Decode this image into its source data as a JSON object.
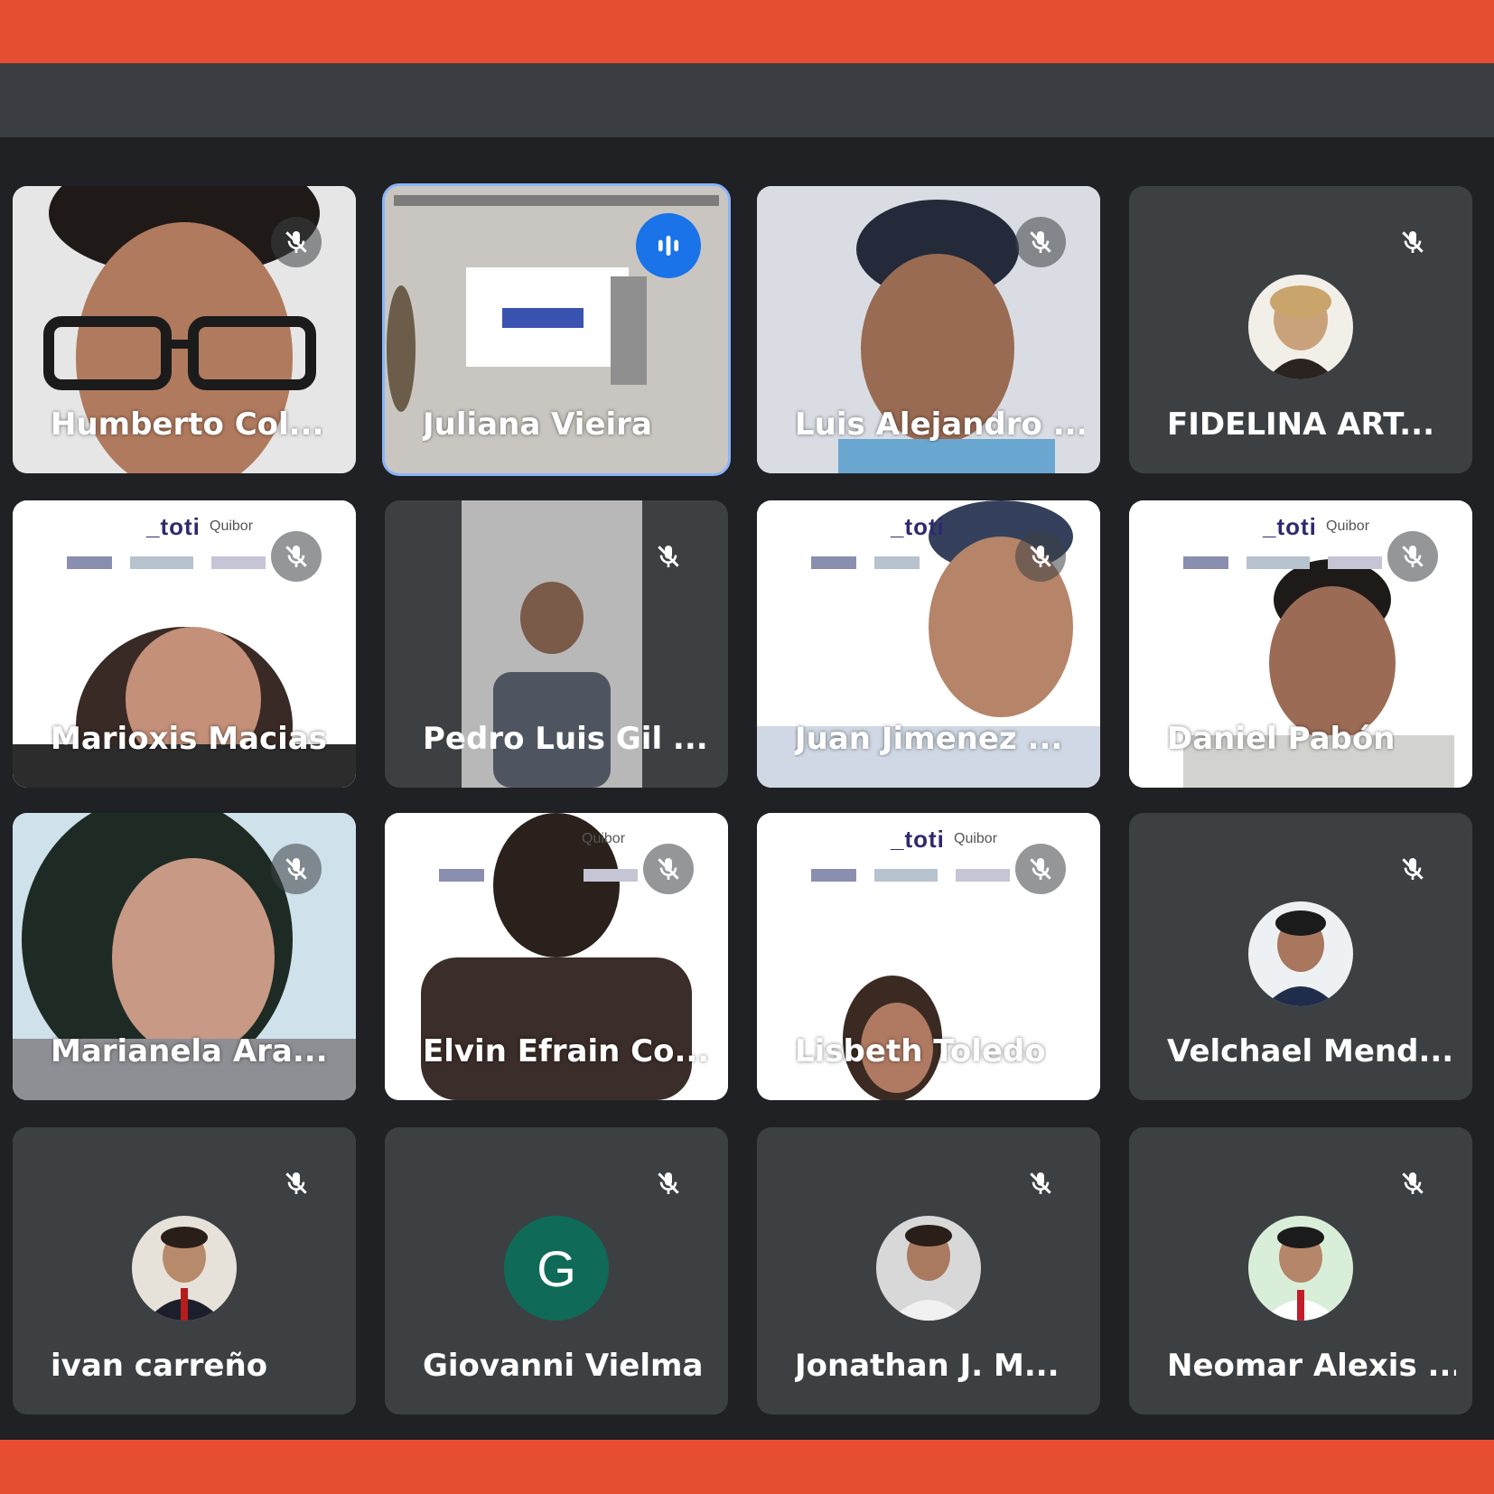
{
  "participants": [
    {
      "name": "Humberto Col...",
      "muted": true
    },
    {
      "name": "Juliana Vieira",
      "speaking": true,
      "active": true
    },
    {
      "name": "Luis Alejandro ...",
      "muted": true
    },
    {
      "name": "FIDELINA ART...",
      "muted": true
    },
    {
      "name": "Marioxis Macias",
      "muted": true
    },
    {
      "name": "Pedro Luis Gil ...",
      "muted": true
    },
    {
      "name": "Juan Jimenez ...",
      "muted": true
    },
    {
      "name": "Daniel Pabón",
      "muted": true
    },
    {
      "name": "Marianela Ara...",
      "muted": true
    },
    {
      "name": "Elvin Efrain Co...",
      "muted": true
    },
    {
      "name": "Lisbeth Toledo",
      "muted": true
    },
    {
      "name": "Velchael Mend...",
      "muted": true
    },
    {
      "name": "ivan carreño",
      "muted": true
    },
    {
      "name": "Giovanni Vielma",
      "muted": true,
      "avatar_letter": "G"
    },
    {
      "name": "Jonathan J. M...",
      "muted": true
    },
    {
      "name": "Neomar Alexis ...",
      "muted": true
    }
  ],
  "logo": {
    "brand": "_toti",
    "sub": "Quibor"
  },
  "colors": {
    "frame_bar": "#e64d31",
    "tile_bg": "#3c4043",
    "speaking": "#1a73e8",
    "active_outline": "#8ab4f8",
    "avatar_letter_bg": "#0f6b57"
  }
}
